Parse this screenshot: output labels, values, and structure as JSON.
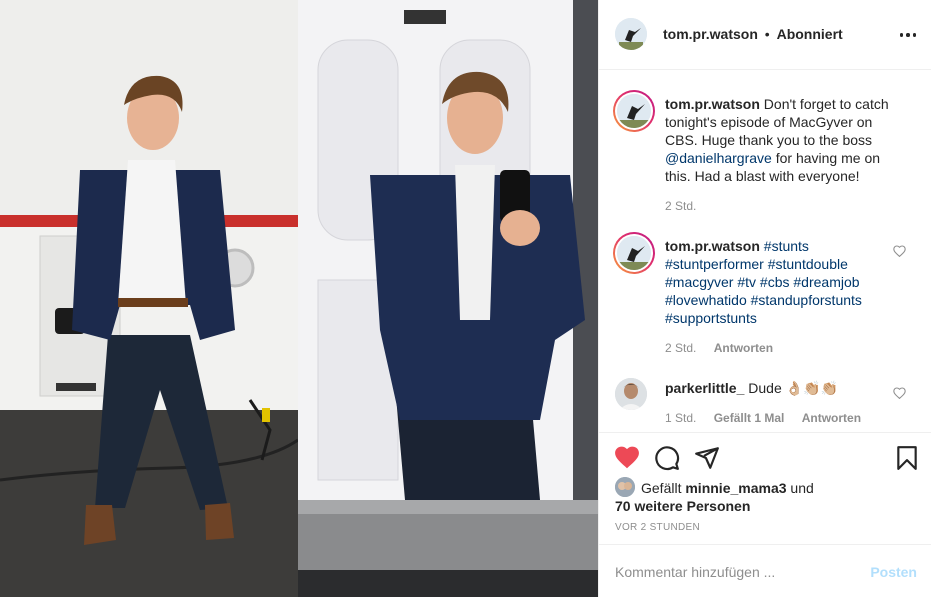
{
  "header": {
    "username": "tom.pr.watson",
    "separator": "•",
    "follow_status": "Abonniert",
    "more_icon": "more-horizontal-icon"
  },
  "caption": {
    "username": "tom.pr.watson",
    "text_1": " Don't forget to catch tonight's episode of MacGyver on CBS. Huge thank you to the boss ",
    "mention": "@danielhargrave",
    "text_2": " for having me on this. Had a blast with everyone!",
    "time": "2 Std."
  },
  "comments": [
    {
      "username": "tom.pr.watson",
      "hashtags": "#stunts #stuntperformer #stuntdouble #macgyver #tv #cbs #dreamjob #lovewhatido #standupforstunts #supportstunts",
      "time": "2 Std.",
      "reply": "Antworten"
    },
    {
      "username": "parkerlittle_",
      "text": " Dude 👌🏼👏🏼👏🏼",
      "time": "1 Std.",
      "likes": "Gefällt 1 Mal",
      "reply": "Antworten"
    }
  ],
  "actions": {
    "icons": [
      "heart-filled-icon",
      "comment-icon",
      "share-icon",
      "bookmark-icon"
    ],
    "accent": "#ed4956"
  },
  "likes": {
    "prefix": "Gefällt ",
    "user": "minnie_mama3",
    "mid": " und",
    "others": "70 weitere Personen"
  },
  "timestamp": "VOR 2 STUNDEN",
  "add_comment": {
    "placeholder": "Kommentar hinzufügen ...",
    "post_label": "Posten",
    "post_color": "#b2dffc"
  }
}
